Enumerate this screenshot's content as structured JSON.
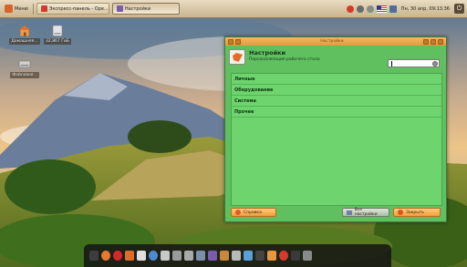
{
  "top_panel": {
    "menu_label": "Меню",
    "tasks": [
      {
        "label": "Экспресс-панель - Ope...",
        "icon": "opera-icon",
        "color": "#d9362a"
      },
      {
        "label": "Настройки",
        "icon": "settings-icon",
        "color": "#7a5bb0",
        "active": true
      }
    ],
    "clock": "Пн, 30 апр, 09:13:36",
    "tray_icons": [
      "opera-turbo-icon",
      "network-icon",
      "volume-icon",
      "us-flag-icon",
      "mail-icon",
      "power-icon"
    ]
  },
  "desktop_icons": [
    {
      "label": "Домашняя...",
      "icon": "home-folder-icon"
    },
    {
      "label": "32,867 ГиБ",
      "icon": "drive-icon"
    },
    {
      "label": "Файловая...",
      "icon": "file-system-icon"
    }
  ],
  "window": {
    "title": "Настройки",
    "header_title": "Настройки",
    "header_subtitle": "Персонализация рабочего стола",
    "search_value": "",
    "categories": [
      "Личные",
      "Оборудование",
      "Система",
      "Прочее"
    ],
    "buttons": {
      "help": "Справка",
      "all_settings": "Все настройки",
      "close": "Закрыть"
    }
  },
  "dock": {
    "items": [
      {
        "name": "terminal-icon",
        "color": "#3d3d3d"
      },
      {
        "name": "firefox-icon",
        "color": "#e6782f"
      },
      {
        "name": "opera-icon",
        "color": "#d8262a"
      },
      {
        "name": "files-icon",
        "color": "#e06b27"
      },
      {
        "name": "document-icon",
        "color": "#dfdfdf"
      },
      {
        "name": "chromium-icon",
        "color": "#4d8ad6"
      },
      {
        "name": "text-editor-icon",
        "color": "#c8c8c8"
      },
      {
        "name": "calculator-icon",
        "color": "#9a9a9a"
      },
      {
        "name": "clipboard-icon",
        "color": "#aaaaaa"
      },
      {
        "name": "screenshot-icon",
        "color": "#7d8fa8"
      },
      {
        "name": "settings-icon",
        "color": "#7a5bb0"
      },
      {
        "name": "folder-icon",
        "color": "#c68a3a"
      },
      {
        "name": "archive-icon",
        "color": "#b9b9b9"
      },
      {
        "name": "photo-icon",
        "color": "#5aa0d8"
      },
      {
        "name": "video-icon",
        "color": "#444444"
      },
      {
        "name": "music-icon",
        "color": "#e8973c"
      },
      {
        "name": "record-icon",
        "color": "#d83a2a"
      },
      {
        "name": "monitor-icon",
        "color": "#3a3a3a"
      },
      {
        "name": "trash-icon",
        "color": "#8a8a8a"
      }
    ]
  }
}
